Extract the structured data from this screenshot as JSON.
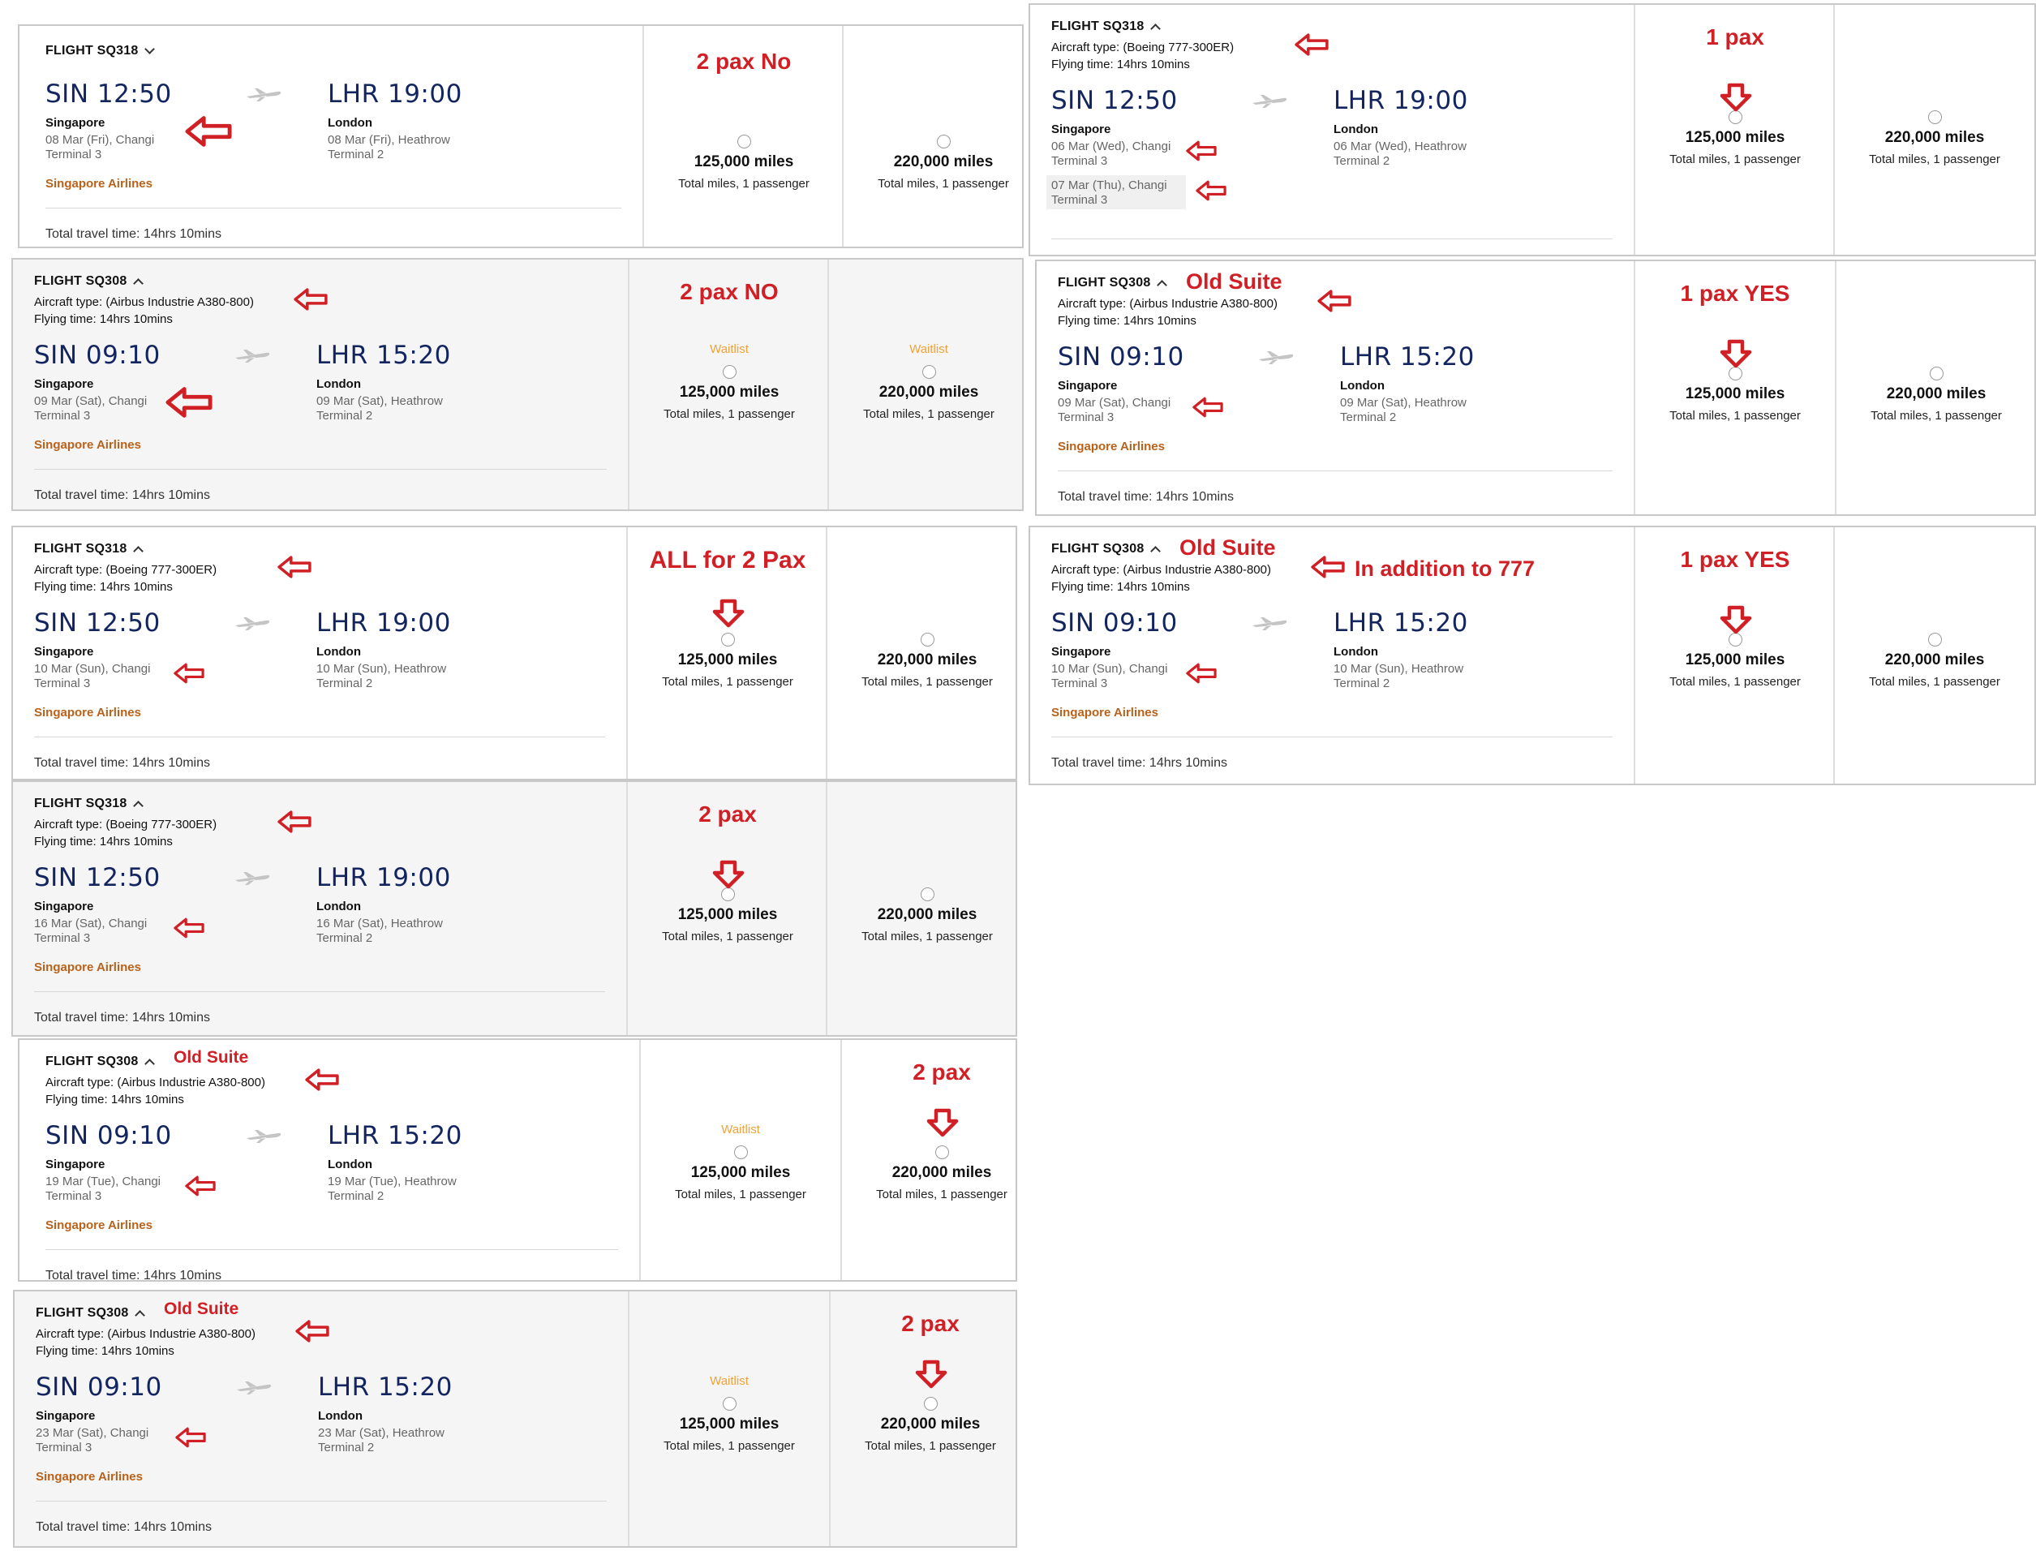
{
  "common": {
    "airline": "Singapore Airlines",
    "total_travel": "Total travel time: 14hrs 10mins",
    "flying_time": "Flying time: 14hrs 10mins",
    "origin_city": "Singapore",
    "dest_city": "London",
    "terminal_origin": "Terminal 3",
    "terminal_dest": "Terminal 2",
    "waitlist": "Waitlist",
    "miles_low": "125,000 miles",
    "miles_high": "220,000 miles",
    "miles_sub": "Total miles, 1 passenger",
    "aircraft_777": "Aircraft type: (Boeing 777-300ER)",
    "aircraft_380": "Aircraft type: (Airbus Industrie A380-800)"
  },
  "cards": [
    {
      "flight": "FLIGHT SQ318",
      "dep_time": "SIN 12:50",
      "arr_time": "LHR 19:00",
      "dep_date": "08 Mar (Fri), Changi",
      "arr_date": "08 Mar (Fri), Heathrow",
      "note": "2 pax No"
    },
    {
      "flight": "FLIGHT SQ308",
      "dep_time": "SIN 09:10",
      "arr_time": "LHR 15:20",
      "dep_date": "09 Mar (Sat), Changi",
      "arr_date": "09 Mar (Sat), Heathrow",
      "note": "2 pax NO"
    },
    {
      "flight": "FLIGHT SQ318",
      "dep_time": "SIN 12:50",
      "arr_time": "LHR 19:00",
      "dep_date": "10 Mar (Sun), Changi",
      "arr_date": "10 Mar (Sun), Heathrow",
      "note": "ALL for 2 Pax"
    },
    {
      "flight": "FLIGHT SQ318",
      "dep_time": "SIN 12:50",
      "arr_time": "LHR 19:00",
      "dep_date": "16 Mar (Sat), Changi",
      "arr_date": "16 Mar (Sat), Heathrow",
      "note": "2 pax"
    },
    {
      "flight": "FLIGHT SQ308",
      "dep_time": "SIN 09:10",
      "arr_time": "LHR 15:20",
      "dep_date": "19 Mar (Tue), Changi",
      "arr_date": "19 Mar (Tue), Heathrow",
      "note": "2 pax",
      "suite_note": "Old Suite"
    },
    {
      "flight": "FLIGHT SQ308",
      "dep_time": "SIN 09:10",
      "arr_time": "LHR 15:20",
      "dep_date": "23 Mar (Sat), Changi",
      "arr_date": "23 Mar (Sat), Heathrow",
      "note": "2 pax",
      "suite_note": "Old Suite"
    },
    {
      "flight": "FLIGHT SQ318",
      "dep_time": "SIN 12:50",
      "arr_time": "LHR 19:00",
      "dep_date": "06 Mar (Wed), Changi",
      "arr_date": "06 Mar (Wed), Heathrow",
      "alt_date": "07 Mar (Thu), Changi",
      "note": "1 pax"
    },
    {
      "flight": "FLIGHT SQ308",
      "dep_time": "SIN 09:10",
      "arr_time": "LHR 15:20",
      "dep_date": "09 Mar (Sat), Changi",
      "arr_date": "09 Mar (Sat), Heathrow",
      "note": "1 pax YES",
      "suite_note": "Old Suite"
    },
    {
      "flight": "FLIGHT SQ308",
      "dep_time": "SIN 09:10",
      "arr_time": "LHR 15:20",
      "dep_date": "10 Mar (Sun), Changi",
      "arr_date": "10 Mar (Sun), Heathrow",
      "note": "1 pax YES",
      "suite_note": "Old Suite",
      "extra_note": "In addition to 777"
    }
  ]
}
